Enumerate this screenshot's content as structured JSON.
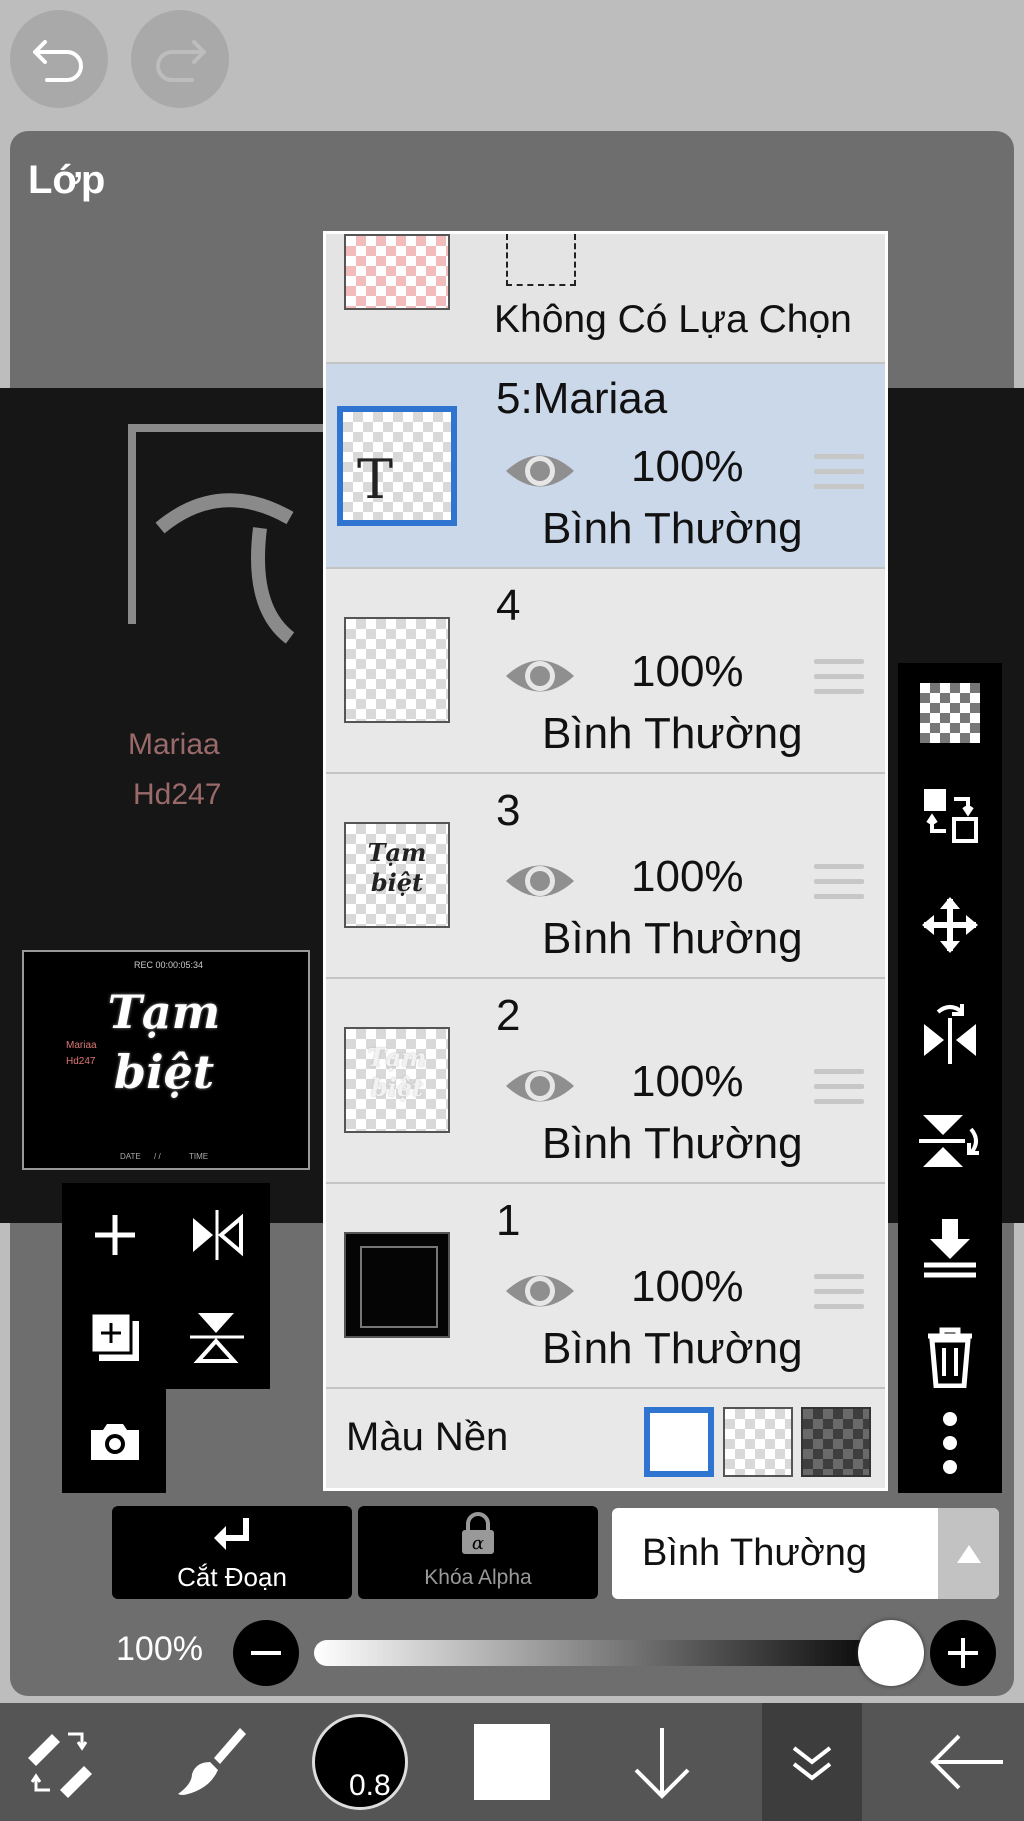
{
  "panel_title": "Lớp",
  "canvas_text": {
    "line1": "Mariaa",
    "line2": "Hd247"
  },
  "selection_row": {
    "label": "Không Có Lựa Chọn"
  },
  "layers": [
    {
      "name": "5:Mariaa",
      "opacity": "100%",
      "blend": "Bình Thường",
      "thumb_glyph": "T",
      "selected": true
    },
    {
      "name": "4",
      "opacity": "100%",
      "blend": "Bình Thường",
      "selected": false
    },
    {
      "name": "3",
      "opacity": "100%",
      "blend": "Bình Thường",
      "thumb_text": "Tạm biệt",
      "selected": false
    },
    {
      "name": "2",
      "opacity": "100%",
      "blend": "Bình Thường",
      "thumb_text": "Tạm biệt",
      "selected": false
    },
    {
      "name": "1",
      "opacity": "100%",
      "blend": "Bình Thường",
      "selected": false
    }
  ],
  "background": {
    "label": "Màu Nền"
  },
  "preview": {
    "rec_text": "REC 00:00:05:34",
    "title": "Tạm biệt",
    "date_label": "DATE",
    "time_label": "TIME",
    "slashes": "/ /"
  },
  "buttons": {
    "clipping": "Cắt Đoạn",
    "alpha_lock": "Khóa Alpha",
    "blend_mode": "Bình Thường"
  },
  "opacity_slider": {
    "label": "100%",
    "value": 1.0
  },
  "brush_size": "0.8",
  "colors": {
    "accent": "#2f74d0",
    "selected_row": "#cbd8ea",
    "panel": "#6e6e6e"
  }
}
